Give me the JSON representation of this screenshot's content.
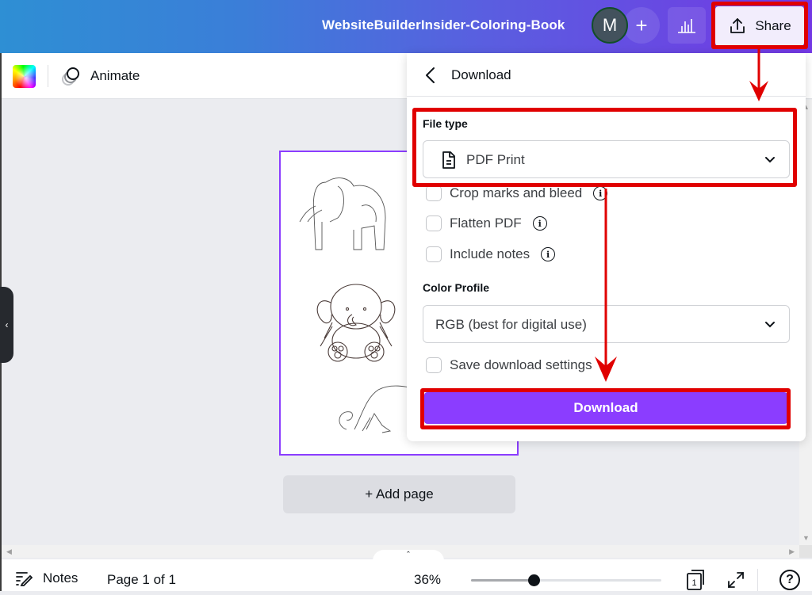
{
  "header": {
    "document_title": "WebsiteBuilderInsider-Coloring-Book",
    "avatar_initial": "M",
    "add_collaborator_icon": "plus-icon",
    "insights_icon": "bar-chart-icon",
    "share_label": "Share",
    "share_icon": "upload-icon"
  },
  "toolbar": {
    "color_icon": "color-palette-icon",
    "animate_label": "Animate",
    "animate_icon": "animate-circles-icon"
  },
  "canvas": {
    "collapse_icon": "chevron-left-icon",
    "add_page_label": "+ Add page",
    "page_illustrations": [
      "elephant-line-drawing",
      "baby-elephant-drawing",
      "monkey-line-drawing"
    ]
  },
  "download_panel": {
    "title": "Download",
    "back_icon": "chevron-left-icon",
    "file_type_label": "File type",
    "file_type_value": "PDF Print",
    "file_type_icon": "document-icon",
    "options": [
      {
        "label": "Crop marks and bleed",
        "checked": false,
        "has_info": true
      },
      {
        "label": "Flatten PDF",
        "checked": false,
        "has_info": true
      },
      {
        "label": "Include notes",
        "checked": false,
        "has_info": true
      }
    ],
    "color_profile_label": "Color Profile",
    "color_profile_value": "RGB (best for digital use)",
    "save_settings_label": "Save download settings",
    "save_settings_checked": false,
    "download_button_label": "Download",
    "accent_color": "#8b3dff"
  },
  "footer": {
    "notes_label": "Notes",
    "page_indicator": "Page 1 of 1",
    "zoom_level": "36%",
    "zoom_fraction": 0.33,
    "pages_count": "1",
    "help_label": "?"
  },
  "annotations": {
    "highlight_color": "#e00000",
    "highlighted": [
      "share-button",
      "file-type-section",
      "download-button"
    ]
  }
}
